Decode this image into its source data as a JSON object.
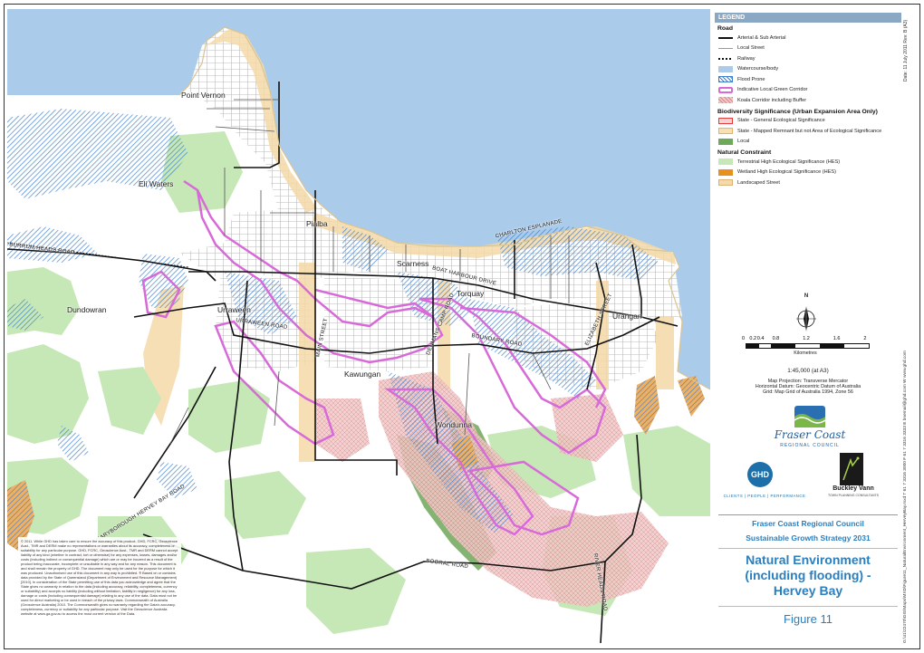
{
  "map": {
    "places": [
      {
        "id": "point-vernon",
        "name": "Point Vernon"
      },
      {
        "id": "eli-waters",
        "name": "Eli Waters"
      },
      {
        "id": "pialba",
        "name": "Pialba"
      },
      {
        "id": "scarness",
        "name": "Scarness"
      },
      {
        "id": "torquay",
        "name": "Torquay"
      },
      {
        "id": "dundowran",
        "name": "Dundowran"
      },
      {
        "id": "urraween",
        "name": "Urraween"
      },
      {
        "id": "urangan",
        "name": "Urangan"
      },
      {
        "id": "kawungan",
        "name": "Kawungan"
      },
      {
        "id": "wondunna",
        "name": "Wondunna"
      }
    ],
    "roads": [
      {
        "id": "charlton",
        "name": "CHARLTON ESPLANADE"
      },
      {
        "id": "burrum",
        "name": "BURRUM HEADS ROAD"
      },
      {
        "id": "boat-harbour",
        "name": "BOAT HARBOUR DRIVE"
      },
      {
        "id": "denmans",
        "name": "DENMANS CAMP ROAD"
      },
      {
        "id": "elizabeth",
        "name": "ELIZABETH STREET"
      },
      {
        "id": "urraween-rd",
        "name": "URRAWEEN ROAD"
      },
      {
        "id": "boundary",
        "name": "BOUNDARY ROAD"
      },
      {
        "id": "main",
        "name": "MAIN STREET"
      },
      {
        "id": "maryborough",
        "name": "MARYBOROUGH HERVEY BAY ROAD"
      },
      {
        "id": "booral",
        "name": "BOORAL ROAD"
      },
      {
        "id": "river-heads",
        "name": "RIVER HEADS ROAD"
      }
    ],
    "colors": {
      "sea": "#aacbea",
      "landscape": "#f7dcae",
      "local": "#5e9a4a",
      "hes": "#b7e3a6",
      "corridor": "#d76ad8",
      "flood": "#3b7fd1",
      "koala": "#e7a4a4",
      "wetland": "#e8901b",
      "road": "#111111"
    }
  },
  "legend": {
    "title": "LEGEND",
    "road_heading": "Road",
    "items_road": [
      {
        "label": "Arterial & Sub Arterial",
        "swatch": "arterial"
      },
      {
        "label": "Local Street",
        "swatch": "local-street"
      },
      {
        "label": "Railway",
        "swatch": "railway"
      },
      {
        "label": "Watercourse/body",
        "swatch": "watercourse"
      },
      {
        "label": "Flood Prone",
        "swatch": "flood"
      },
      {
        "label": "Indicative Local Green Corridor",
        "swatch": "corridor"
      },
      {
        "label": "Koala Corridor including Buffer",
        "swatch": "koala"
      }
    ],
    "bio_heading": "Biodiversity Significance (Urban Expansion Area Only)",
    "items_bio": [
      {
        "label": "State - General Ecological Significance",
        "swatch": "state-general"
      },
      {
        "label": "State - Mapped Remnant but not Area of Ecological Significance",
        "swatch": "state-remnant"
      },
      {
        "label": "Local",
        "swatch": "local"
      }
    ],
    "nat_heading": "Natural Constraint",
    "items_nat": [
      {
        "label": "Terrestrial High Ecological Significance (HES)",
        "swatch": "hes"
      },
      {
        "label": "Wetland High Ecological Significance (HES)",
        "swatch": "wetland"
      },
      {
        "label": "Landscaped Street",
        "swatch": "landscaped"
      }
    ]
  },
  "date_text": "Date: 11 July 2011   Rev: B (A3)",
  "north": "N",
  "scale": {
    "ticks": [
      "0",
      "0.2",
      "0.4",
      "0.8",
      "1.2",
      "1.6",
      "2"
    ],
    "unit": "Kilometres",
    "ratio": "1:45,000   (at A3)"
  },
  "projection": [
    "Map Projection: Transverse Mercator",
    "Horizontal Datum: Geocentric Datum of Australia",
    "Grid: Map Grid of Australia 1994, Zone 56"
  ],
  "logos": {
    "council_name": "Fraser Coast",
    "council_sub": "REGIONAL COUNCIL",
    "ghd": "GHD",
    "ghd_tagline": "CLIENTS | PEOPLE | PERFORMANCE",
    "buckley": "Buckley Vann",
    "buckley_tagline": "TOWN PLANNING CONSULTANTS"
  },
  "title": {
    "client": "Fraser Coast Regional Council",
    "project": "Sustainable Growth Strategy 2031",
    "map_title": "Natural Environment (including flooding) - Hervey Bay",
    "figure": "Figure 11"
  },
  "side_text": "G:\\41\\22470\\GIS\\Maps\\MXD\\Figure11_NaturalEnvironment_HerveyBay.mxd   T 61 7 3316 3000  F 61 7 3316 3333   E bnemail@ghd.com  W www.ghd.com",
  "copyright": "© 2011. While GHD has taken care to ensure the accuracy of this product, GHD, FCRC, Geoscience Aust., TMR and DERM make no representations or warranties about its accuracy, completeness or suitability for any particular purpose. GHD, FCRC, Geoscience Aust., TMR and DERM cannot accept liability of any kind (whether in contract, tort or otherwise) for any expenses, losses, damages and/or costs (including indirect or consequential damage) which are or may be incurred as a result of the product being inaccurate, incomplete or unsuitable in any way and for any reason. This document is and shall remain the property of GHD. The document may only be used for the purpose for which it was produced. Unauthorised use of this document in any way is prohibited. ® Based on or contains data provided by the State of Queensland (Department of Environment and Resource Management) [2010]. In consideration of the State permitting use of this data you acknowledge and agree that the State gives no warranty in relation to the data (including accuracy, reliability, completeness, currency or suitability) and accepts no liability (including without limitation, liability in negligence) for any loss, damage or costs (including consequential damage) relating to any use of the data. Data must not be used for direct marketing or be used in breach of the privacy laws. Commonwealth of Australia (Geoscience Australia) 2010. The Commonwealth gives no warranty regarding the Data's accuracy, completeness, currency or suitability for any particular purpose. Visit the Geoscience Australia website at www.ga.gov.au to access the most current version of the Data."
}
